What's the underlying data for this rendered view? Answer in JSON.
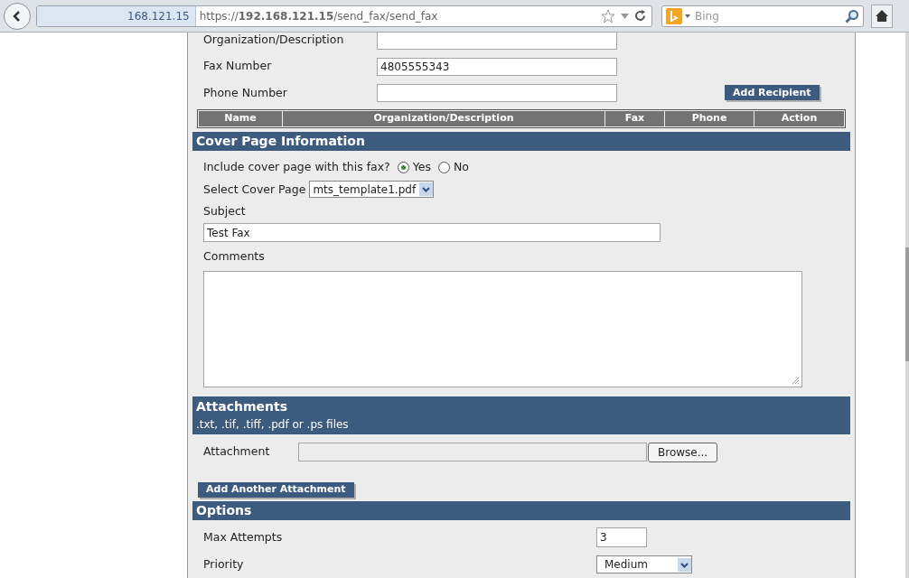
{
  "browser": {
    "identity": "168.121.15",
    "url": "https://**192.168.121.15**/send_fax/send_fax",
    "search_engine": "Bing"
  },
  "recipient_fields": [
    {
      "label": "Organization/Description"
    },
    {
      "label": "Fax Number",
      "value": "4805555343"
    },
    {
      "label": "Phone Number"
    }
  ],
  "add_recipient_button": "Add Recipient",
  "recipients_table": {
    "columns": [
      "Name",
      "Organization/Description",
      "Fax",
      "Phone",
      "Action"
    ]
  },
  "cover_page": {
    "title": "Cover Page Information",
    "include_label": "Include cover page with this fax?",
    "include_options": [
      {
        "label": "Yes",
        "selected": true
      },
      {
        "label": "No",
        "selected": false
      }
    ],
    "select_label": "Select Cover Page",
    "select_value": "mts_template1.pdf",
    "subject_label": "Subject",
    "subject_value": "Test Fax",
    "comments_label": "Comments"
  },
  "attachments": {
    "title": "Attachments",
    "subtitle": ".txt, .tif, .tiff, .pdf or .ps files",
    "attachment_label": "Attachment",
    "browse_button": "Browse...",
    "add_another_button": "Add Another Attachment"
  },
  "options": {
    "title": "Options",
    "fields": [
      {
        "kind": "text",
        "label": "Max Attempts",
        "value": "3"
      },
      {
        "kind": "select",
        "label": "Priority",
        "value": "Medium"
      }
    ]
  }
}
